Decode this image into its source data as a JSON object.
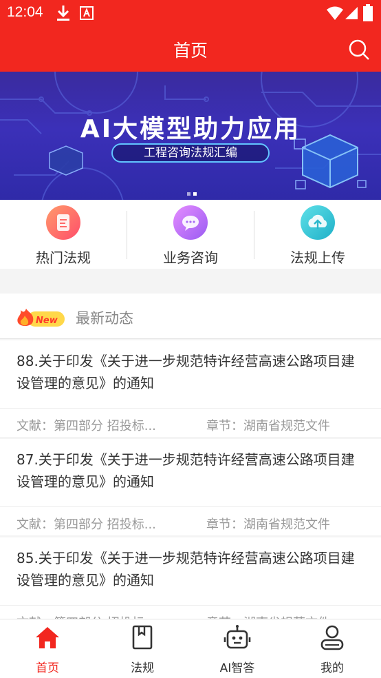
{
  "status_bar": {
    "time": "12:04",
    "icons": [
      "download-icon",
      "font-a-icon",
      "wifi-icon",
      "signal-icon",
      "battery-icon"
    ]
  },
  "header": {
    "title": "首页",
    "search_icon": "search-icon",
    "color": "#f2271f"
  },
  "banner": {
    "headline": "AI大模型助力应用",
    "subtitle": "工程咨询法规汇编"
  },
  "quick_entries": [
    {
      "label": "热门法规",
      "icon": "document-icon"
    },
    {
      "label": "业务咨询",
      "icon": "chat-icon"
    },
    {
      "label": "法规上传",
      "icon": "cloud-upload-icon"
    }
  ],
  "news": {
    "badge": "New",
    "label": "最新动态",
    "items": [
      {
        "title": "88.关于印发《关于进一步规范特许经营高速公路项目建设管理的意见》的通知",
        "doc": "文献：第四部分 招投标...",
        "chapter": "章节：湖南省规范文件"
      },
      {
        "title": "87.关于印发《关于进一步规范特许经营高速公路项目建设管理的意见》的通知",
        "doc": "文献：第四部分 招投标...",
        "chapter": "章节：湖南省规范文件"
      },
      {
        "title": "85.关于印发《关于进一步规范特许经营高速公路项目建设管理的意见》的通知",
        "doc": "文献：第四部分 招投标...",
        "chapter": "章节：湖南省规范文件"
      }
    ]
  },
  "tabbar": {
    "active_color": "#f2271f",
    "tabs": [
      {
        "label": "首页",
        "icon": "home-icon",
        "active": true
      },
      {
        "label": "法规",
        "icon": "book-icon",
        "active": false
      },
      {
        "label": "AI智答",
        "icon": "robot-icon",
        "active": false
      },
      {
        "label": "我的",
        "icon": "user-icon",
        "active": false
      }
    ]
  }
}
